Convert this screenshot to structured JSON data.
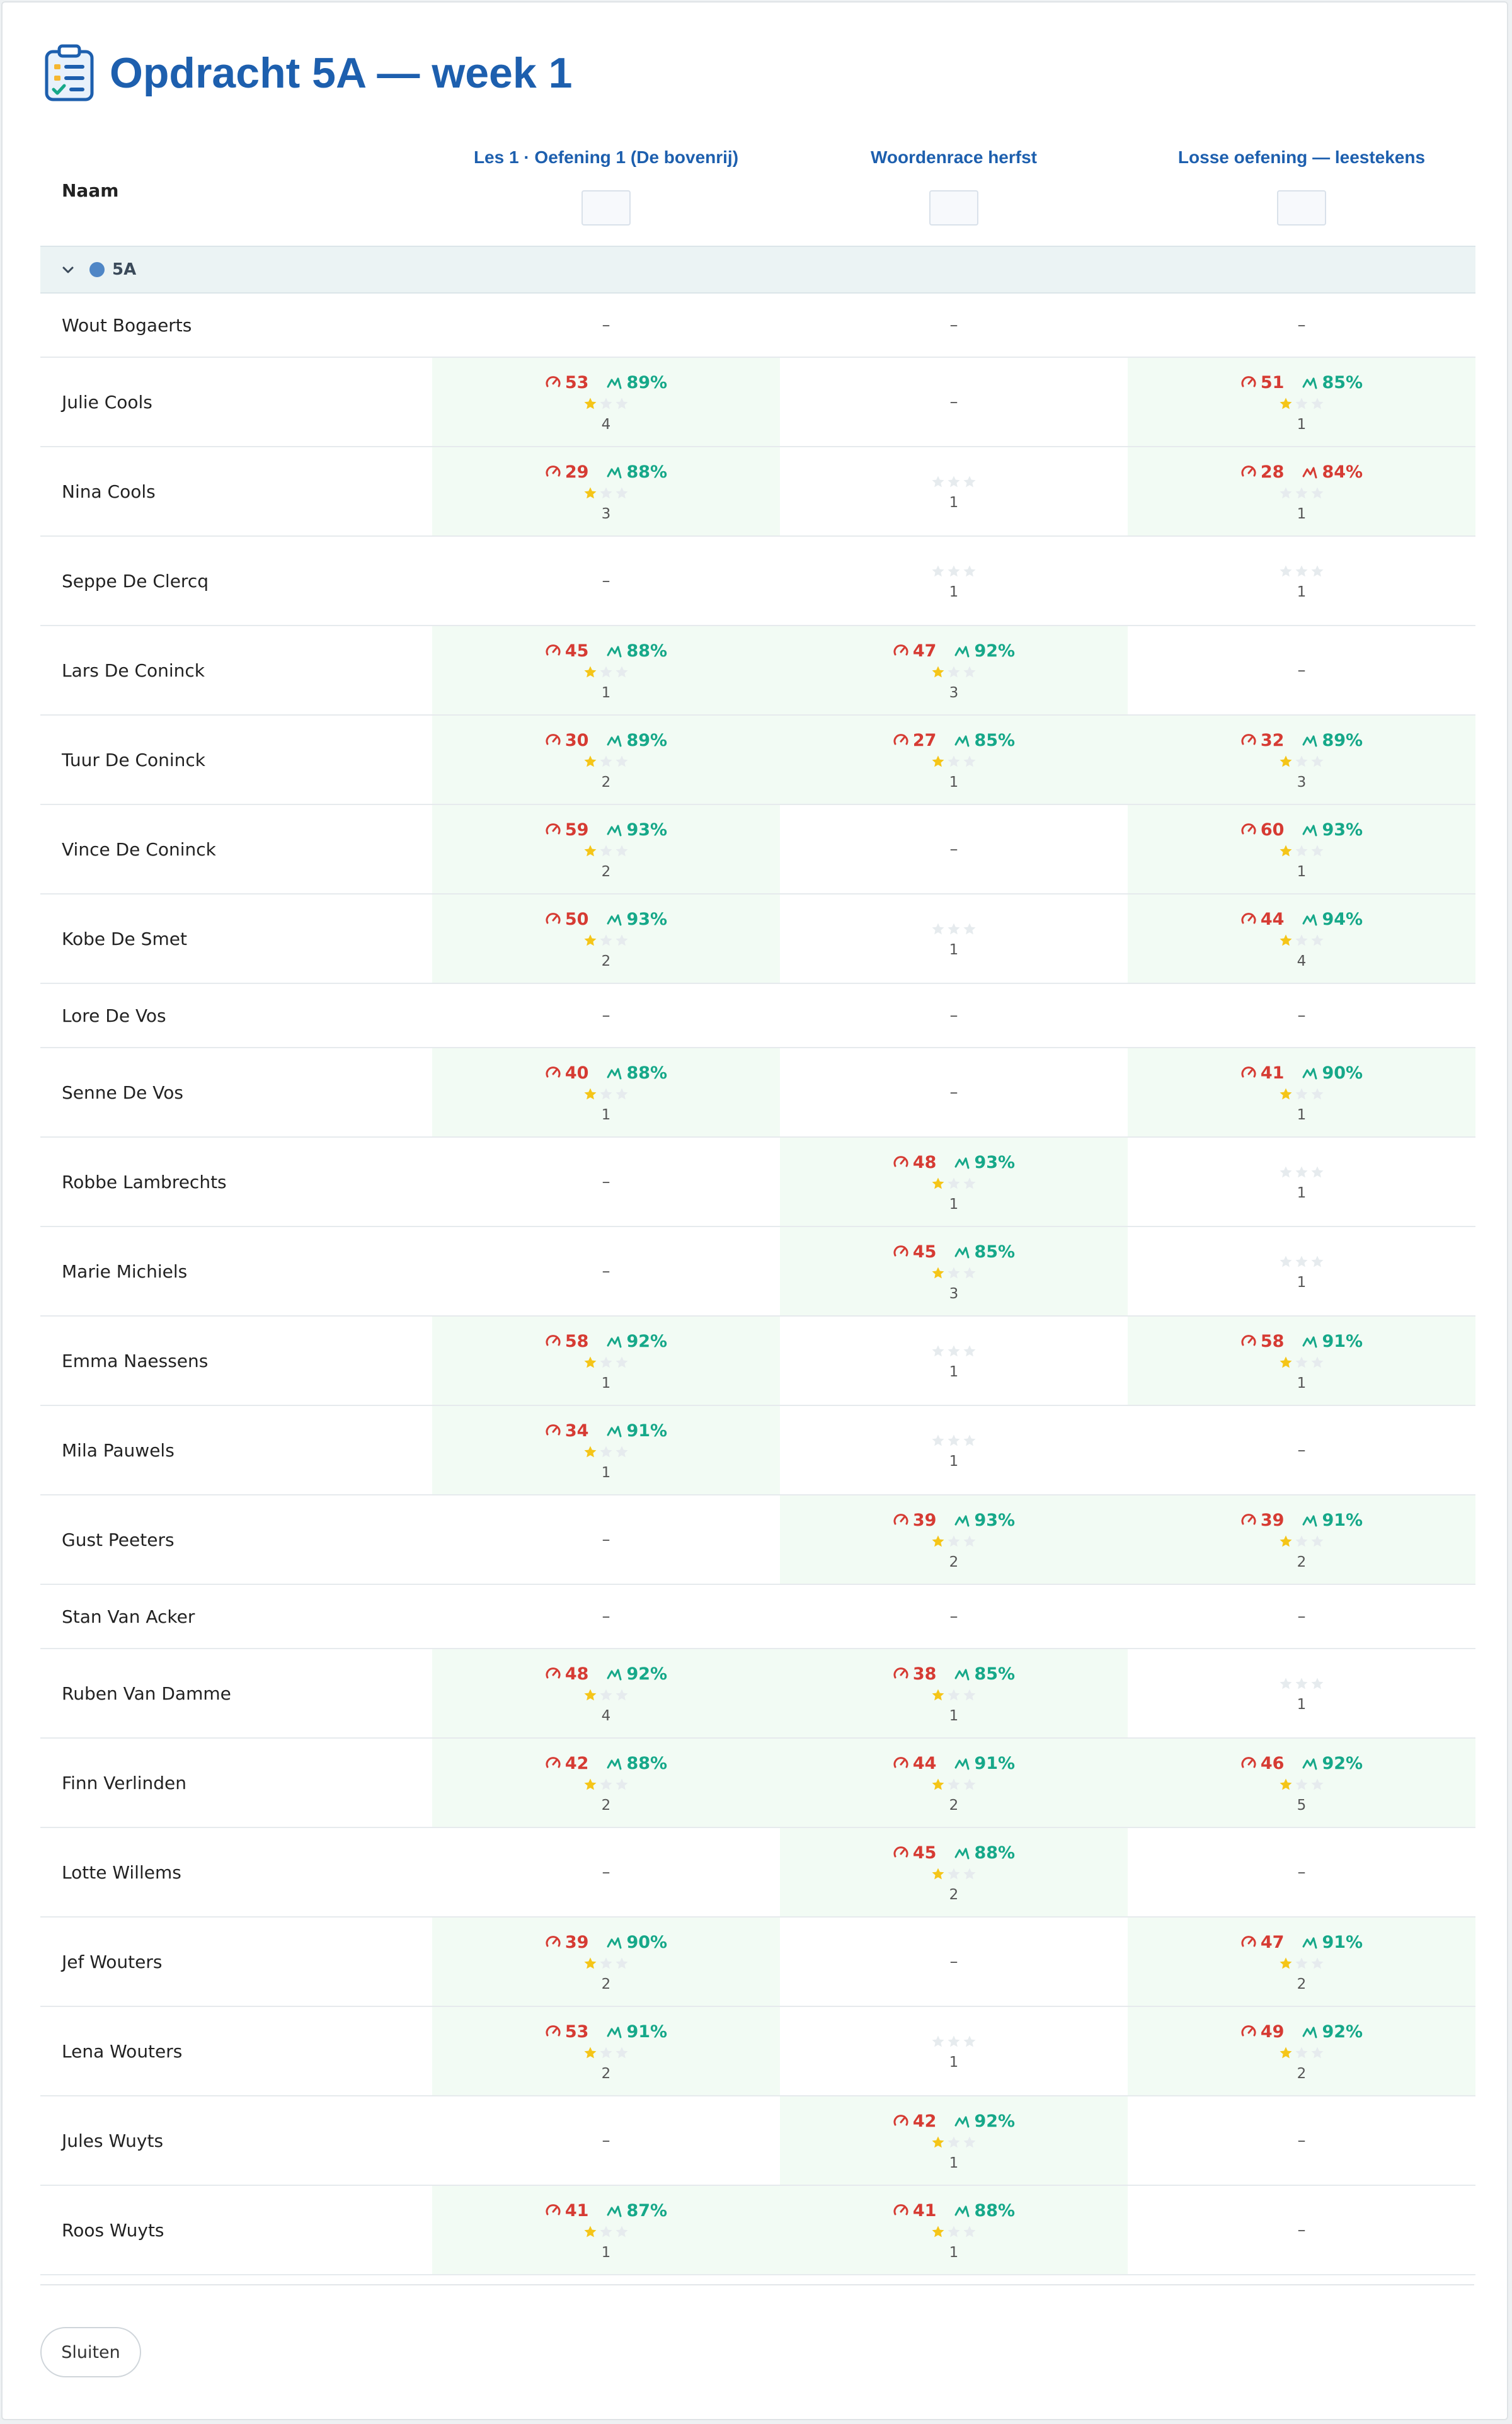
{
  "title": "Opdracht 5A — week 1",
  "columns": {
    "name": "Naam",
    "exercises": [
      "Les 1 · Oefening 1 (De bovenrij)",
      "Woordenrace herfst",
      "Losse oefening — leestekens"
    ]
  },
  "group": {
    "name": "5A",
    "color": "#4f86c6"
  },
  "colors": {
    "brand": "#1d5fae",
    "score_red": "#d63b33",
    "score_green": "#16a889",
    "done_bg": "#f2fbf4",
    "star_filled": "#f5c518",
    "star_empty": "#e6ebee"
  },
  "icons": {
    "header": "clipboard-checklist-icon",
    "speed": "speedometer-icon",
    "accuracy": "accuracy-trend-icon",
    "star": "star-icon",
    "collapse": "chevron-down-icon"
  },
  "empty_mark": "–",
  "rows": [
    {
      "name": "Wout Bogaerts",
      "cells": [
        null,
        null,
        null
      ]
    },
    {
      "name": "Julie Cools",
      "cells": [
        {
          "speed": "53",
          "acc": "89%",
          "stars": 1,
          "attempts": "4"
        },
        null,
        {
          "speed": "51",
          "acc": "85%",
          "stars": 1,
          "attempts": "1"
        }
      ]
    },
    {
      "name": "Nina Cools",
      "cells": [
        {
          "speed": "29",
          "acc": "88%",
          "stars": 1,
          "attempts": "3"
        },
        {
          "stars": 0,
          "attempts": "1"
        },
        {
          "speed": "28",
          "acc": "84%",
          "acc_low": true,
          "stars": 0,
          "attempts": "1"
        }
      ]
    },
    {
      "name": "Seppe De Clercq",
      "cells": [
        null,
        {
          "stars": 0,
          "attempts": "1"
        },
        {
          "stars": 0,
          "attempts": "1"
        }
      ]
    },
    {
      "name": "Lars De Coninck",
      "cells": [
        {
          "speed": "45",
          "acc": "88%",
          "stars": 1,
          "attempts": "1"
        },
        {
          "speed": "47",
          "acc": "92%",
          "stars": 1,
          "attempts": "3"
        },
        null
      ]
    },
    {
      "name": "Tuur De Coninck",
      "cells": [
        {
          "speed": "30",
          "acc": "89%",
          "stars": 1,
          "attempts": "2"
        },
        {
          "speed": "27",
          "acc": "85%",
          "stars": 1,
          "attempts": "1"
        },
        {
          "speed": "32",
          "acc": "89%",
          "stars": 1,
          "attempts": "3"
        }
      ]
    },
    {
      "name": "Vince De Coninck",
      "cells": [
        {
          "speed": "59",
          "acc": "93%",
          "stars": 1,
          "attempts": "2"
        },
        null,
        {
          "speed": "60",
          "acc": "93%",
          "stars": 1,
          "attempts": "1"
        }
      ]
    },
    {
      "name": "Kobe De Smet",
      "cells": [
        {
          "speed": "50",
          "acc": "93%",
          "stars": 1,
          "attempts": "2"
        },
        {
          "stars": 0,
          "attempts": "1"
        },
        {
          "speed": "44",
          "acc": "94%",
          "stars": 1,
          "attempts": "4"
        }
      ]
    },
    {
      "name": "Lore De Vos",
      "cells": [
        null,
        null,
        null
      ]
    },
    {
      "name": "Senne De Vos",
      "cells": [
        {
          "speed": "40",
          "acc": "88%",
          "stars": 1,
          "attempts": "1"
        },
        null,
        {
          "speed": "41",
          "acc": "90%",
          "stars": 1,
          "attempts": "1"
        }
      ]
    },
    {
      "name": "Robbe Lambrechts",
      "cells": [
        null,
        {
          "speed": "48",
          "acc": "93%",
          "stars": 1,
          "attempts": "1"
        },
        {
          "stars": 0,
          "attempts": "1"
        }
      ]
    },
    {
      "name": "Marie Michiels",
      "cells": [
        null,
        {
          "speed": "45",
          "acc": "85%",
          "stars": 1,
          "attempts": "3"
        },
        {
          "stars": 0,
          "attempts": "1"
        }
      ]
    },
    {
      "name": "Emma Naessens",
      "cells": [
        {
          "speed": "58",
          "acc": "92%",
          "stars": 1,
          "attempts": "1"
        },
        {
          "stars": 0,
          "attempts": "1"
        },
        {
          "speed": "58",
          "acc": "91%",
          "stars": 1,
          "attempts": "1"
        }
      ]
    },
    {
      "name": "Mila Pauwels",
      "cells": [
        {
          "speed": "34",
          "acc": "91%",
          "stars": 1,
          "attempts": "1"
        },
        {
          "stars": 0,
          "attempts": "1"
        },
        null
      ]
    },
    {
      "name": "Gust Peeters",
      "cells": [
        null,
        {
          "speed": "39",
          "acc": "93%",
          "stars": 1,
          "attempts": "2"
        },
        {
          "speed": "39",
          "acc": "91%",
          "stars": 1,
          "attempts": "2"
        }
      ]
    },
    {
      "name": "Stan Van Acker",
      "cells": [
        null,
        null,
        null
      ]
    },
    {
      "name": "Ruben Van Damme",
      "cells": [
        {
          "speed": "48",
          "acc": "92%",
          "stars": 1,
          "attempts": "4"
        },
        {
          "speed": "38",
          "acc": "85%",
          "stars": 1,
          "attempts": "1"
        },
        {
          "stars": 0,
          "attempts": "1"
        }
      ]
    },
    {
      "name": "Finn Verlinden",
      "cells": [
        {
          "speed": "42",
          "acc": "88%",
          "stars": 1,
          "attempts": "2"
        },
        {
          "speed": "44",
          "acc": "91%",
          "stars": 1,
          "attempts": "2"
        },
        {
          "speed": "46",
          "acc": "92%",
          "stars": 1,
          "attempts": "5"
        }
      ]
    },
    {
      "name": "Lotte Willems",
      "cells": [
        null,
        {
          "speed": "45",
          "acc": "88%",
          "stars": 1,
          "attempts": "2"
        },
        null
      ]
    },
    {
      "name": "Jef Wouters",
      "cells": [
        {
          "speed": "39",
          "acc": "90%",
          "stars": 1,
          "attempts": "2"
        },
        null,
        {
          "speed": "47",
          "acc": "91%",
          "stars": 1,
          "attempts": "2"
        }
      ]
    },
    {
      "name": "Lena Wouters",
      "cells": [
        {
          "speed": "53",
          "acc": "91%",
          "stars": 1,
          "attempts": "2"
        },
        {
          "stars": 0,
          "attempts": "1"
        },
        {
          "speed": "49",
          "acc": "92%",
          "stars": 1,
          "attempts": "2"
        }
      ]
    },
    {
      "name": "Jules Wuyts",
      "cells": [
        null,
        {
          "speed": "42",
          "acc": "92%",
          "stars": 1,
          "attempts": "1"
        },
        null
      ]
    },
    {
      "name": "Roos Wuyts",
      "cells": [
        {
          "speed": "41",
          "acc": "87%",
          "stars": 1,
          "attempts": "1"
        },
        {
          "speed": "41",
          "acc": "88%",
          "stars": 1,
          "attempts": "1"
        },
        null
      ]
    }
  ],
  "footer": {
    "close_label": "Sluiten"
  }
}
